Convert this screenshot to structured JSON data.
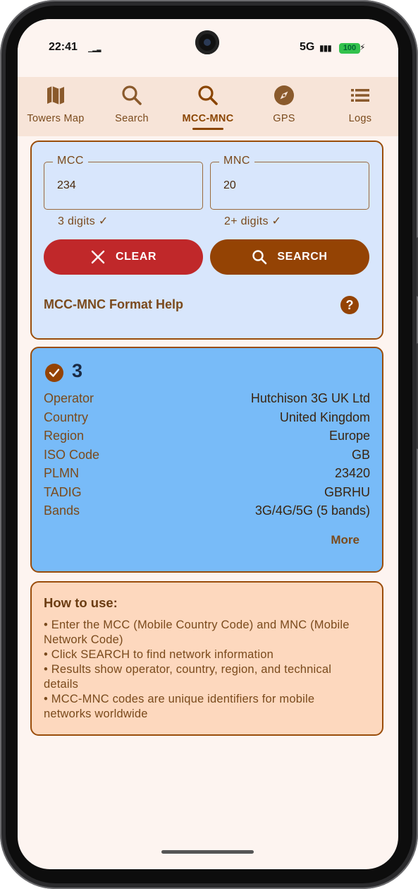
{
  "status": {
    "time": "22:41",
    "network": "5G",
    "battery": "100"
  },
  "tabs": [
    {
      "label": "Towers Map",
      "icon": "map-icon"
    },
    {
      "label": "Search",
      "icon": "search-icon"
    },
    {
      "label": "MCC-MNC",
      "icon": "search-icon",
      "active": true
    },
    {
      "label": "GPS",
      "icon": "compass-icon"
    },
    {
      "label": "Logs",
      "icon": "list-icon"
    }
  ],
  "form": {
    "mcc_label": "MCC",
    "mcc_value": "234",
    "mcc_hint": "3 digits ✓",
    "mnc_label": "MNC",
    "mnc_value": "20",
    "mnc_hint": "2+ digits ✓",
    "clear_label": "CLEAR",
    "search_label": "SEARCH",
    "help_label": "MCC-MNC Format Help",
    "help_icon": "?"
  },
  "result": {
    "title": "3",
    "rows": [
      {
        "key": "Operator",
        "value": "Hutchison 3G UK Ltd"
      },
      {
        "key": "Country",
        "value": "United Kingdom"
      },
      {
        "key": "Region",
        "value": "Europe"
      },
      {
        "key": "ISO Code",
        "value": "GB"
      },
      {
        "key": "PLMN",
        "value": "23420"
      },
      {
        "key": "TADIG",
        "value": "GBRHU"
      },
      {
        "key": "Bands",
        "value": "3G/4G/5G (5 bands)"
      }
    ],
    "more_label": "More"
  },
  "howto": {
    "title": "How to use:",
    "lines": [
      "• Enter the MCC (Mobile Country Code) and MNC (Mobile Network Code)",
      "• Click SEARCH to find network information",
      "• Results show operator, country, region, and technical details",
      "• MCC-MNC codes are unique identifiers for mobile networks worldwide"
    ]
  },
  "colors": {
    "accent": "#944304",
    "clear": "#c0282a",
    "form_card": "#d8e6fc",
    "result_card": "#78bbf8",
    "howto_card": "#fdd8be",
    "tabbar": "#f7e4d8"
  }
}
